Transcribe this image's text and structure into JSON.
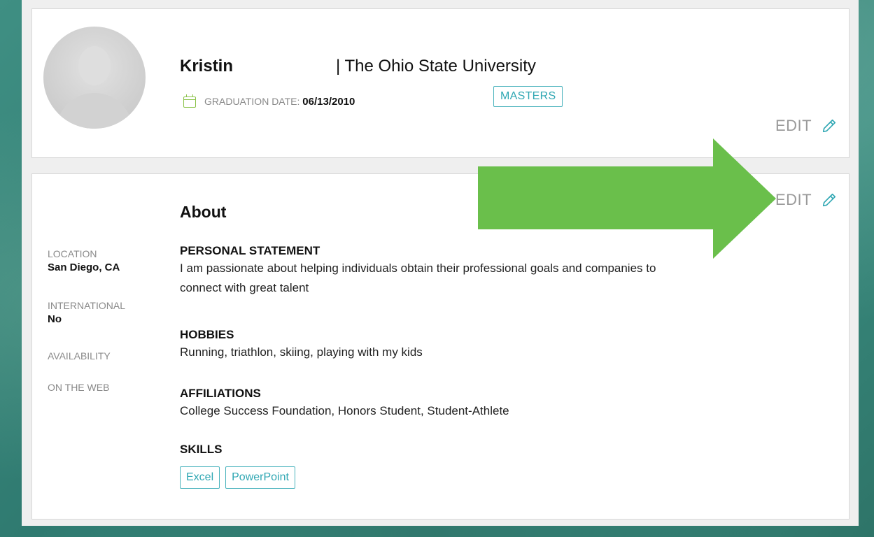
{
  "profile": {
    "name": "Kristin",
    "school": "| The Ohio State University",
    "graduation_label": "GRADUATION DATE:",
    "graduation_date": "06/13/2010",
    "degree_badge": "MASTERS",
    "edit_label": "EDIT"
  },
  "about": {
    "title": "About",
    "edit_label": "EDIT",
    "sidebar": {
      "location_label": "LOCATION",
      "location_value": "San Diego, CA",
      "international_label": "INTERNATIONAL",
      "international_value": "No",
      "availability_label": "AVAILABILITY",
      "on_the_web_label": "ON THE WEB"
    },
    "personal_statement_heading": "PERSONAL STATEMENT",
    "personal_statement_line1": "I am passionate about helping individuals obtain their professional goals and companies to",
    "personal_statement_line2": "connect with great talent",
    "hobbies_heading": "HOBBIES",
    "hobbies": "Running, triathlon, skiing, playing with my kids",
    "affiliations_heading": "AFFILIATIONS",
    "affiliations": "College Success Foundation, Honors Student, Student-Athlete",
    "skills_heading": "SKILLS",
    "skills": [
      "Excel",
      "PowerPoint"
    ]
  },
  "colors": {
    "accent_teal": "#2fa7b3",
    "arrow_green": "#6abf4b",
    "calendar_green": "#8bc34a"
  },
  "icons": [
    "calendar-icon",
    "pencil-icon",
    "arrow-annotation"
  ]
}
